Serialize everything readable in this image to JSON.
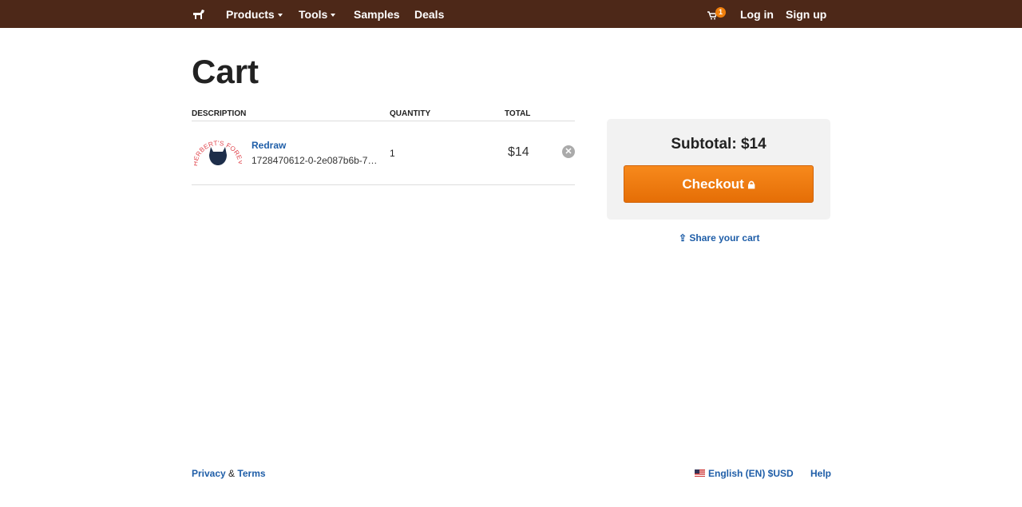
{
  "nav": {
    "products": "Products",
    "tools": "Tools",
    "samples": "Samples",
    "deals": "Deals",
    "cart_count": "1",
    "login": "Log in",
    "signup": "Sign up"
  },
  "page_title": "Cart",
  "table": {
    "headers": [
      "DESCRIPTION",
      "QUANTITY",
      "TOTAL"
    ],
    "items": [
      {
        "name": "Redraw",
        "id": "1728470612-0-2e087b6b-7…",
        "image_text": "HERBERT'S FOREVER HOME",
        "quantity": "1",
        "total": "$14"
      }
    ]
  },
  "summary": {
    "subtotal": "Subtotal: $14",
    "checkout": "Checkout",
    "share": "Share your cart"
  },
  "footer": {
    "privacy": "Privacy",
    "amp": "&",
    "terms": "Terms",
    "locale": "English (EN) $USD",
    "help": "Help"
  }
}
